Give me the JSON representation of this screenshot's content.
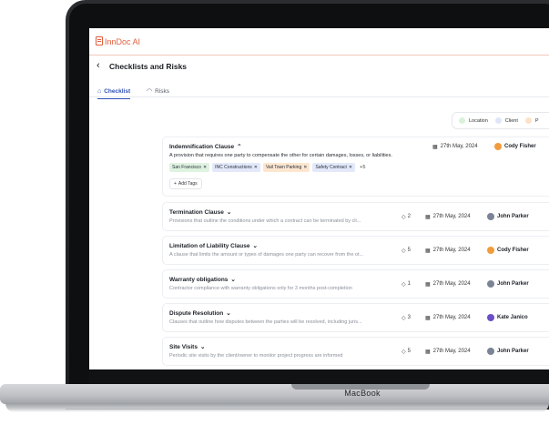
{
  "app": {
    "name": "InnDoc AI"
  },
  "page": {
    "title": "Checklists and Risks"
  },
  "tabs": [
    {
      "label": "Checklist",
      "icon": "home-icon",
      "active": true
    },
    {
      "label": "Risks",
      "icon": "gauge-icon",
      "active": false
    }
  ],
  "legend": [
    {
      "label": "Location",
      "color": "#d9f2da"
    },
    {
      "label": "Client",
      "color": "#dfe6f7"
    },
    {
      "label": "P",
      "color": "#fde2c6"
    }
  ],
  "items": [
    {
      "title": "Indemnification Clause",
      "description": "A provision that requires one party to compensate the other for certain damages, losses, or liabilities.",
      "expanded": true,
      "tags": [
        {
          "label": "San Francisco",
          "color": "#dff3e0"
        },
        {
          "label": "INC Constructions",
          "color": "#e3e9f9"
        },
        {
          "label": "Vail Town Parking",
          "color": "#fde6cf"
        },
        {
          "label": "Safety Contract",
          "color": "#e3e9f9"
        }
      ],
      "more_tags": "+5",
      "add_tags_label": "Add Tags",
      "tag_count": "",
      "date": "27th May, 2024",
      "assignee": "Cody Fisher",
      "avatar_color": "#f29b3b"
    },
    {
      "title": "Termination Clause",
      "description": "Provisions that outline the conditions under which a contract can be terminated by cli...",
      "tag_count": "2",
      "date": "27th May, 2024",
      "assignee": "John Parker",
      "avatar_color": "#7b8494"
    },
    {
      "title": "Limitation of Liability Clause",
      "description": "A clause that limits the amount or types of damages one party can recover from the ot...",
      "tag_count": "5",
      "date": "27th May, 2024",
      "assignee": "Cody Fisher",
      "avatar_color": "#f29b3b"
    },
    {
      "title": "Warranty obligations",
      "description": "Contractor compliance with warranty obligations only for 3 months post-completion",
      "tag_count": "1",
      "date": "27th May, 2024",
      "assignee": "John Parker",
      "avatar_color": "#7b8494"
    },
    {
      "title": "Dispute Resolution",
      "description": "Clauses that outline how disputes between the parties will be resolved, including juris...",
      "tag_count": "3",
      "date": "27th May, 2024",
      "assignee": "Kate Janico",
      "avatar_color": "#6b4fc8"
    },
    {
      "title": "Site Visits",
      "description": "Periodic site visits by the client/owner to monitor project progress are informed",
      "tag_count": "5",
      "date": "27th May, 2024",
      "assignee": "John Parker",
      "avatar_color": "#7b8494"
    }
  ],
  "device": {
    "label": "MacBook"
  }
}
